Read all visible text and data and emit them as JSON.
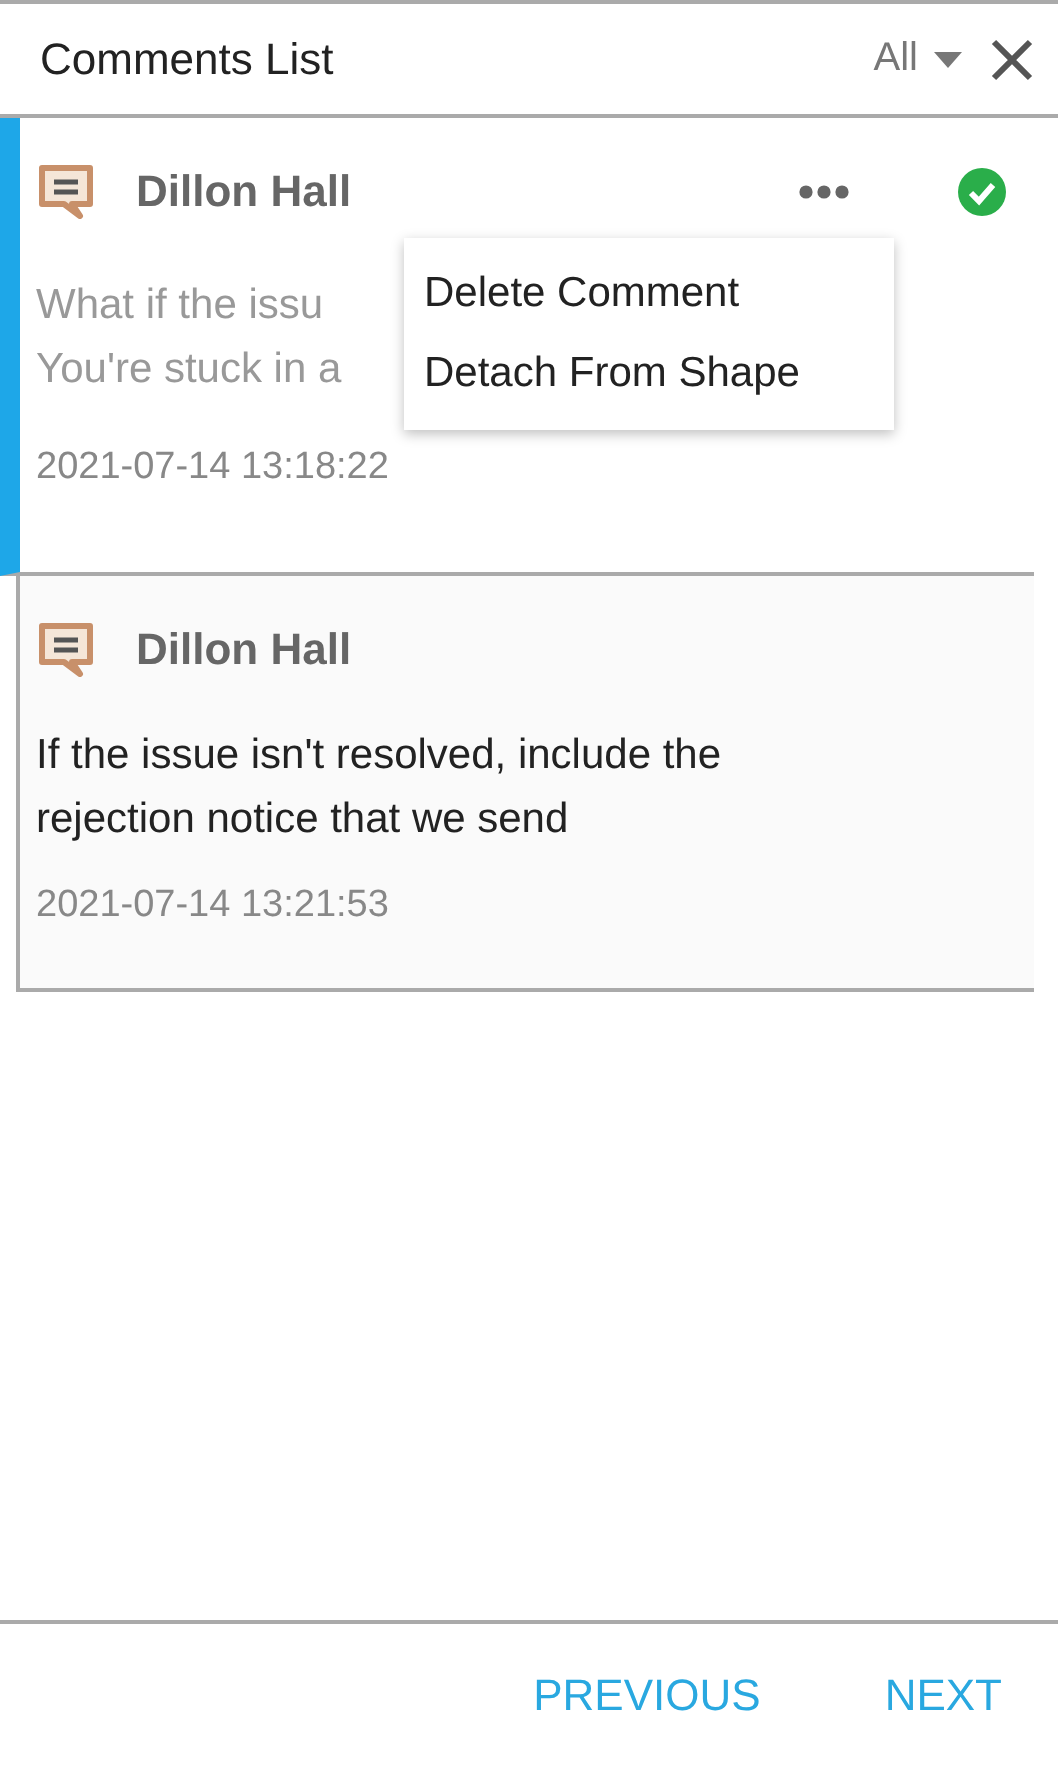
{
  "panel": {
    "title": "Comments List",
    "filter": "All"
  },
  "comments": [
    {
      "author": "Dillon Hall",
      "text_lines": [
        "What if the issu",
        "You're stuck in a"
      ],
      "timestamp": "2021-07-14 13:18:22",
      "selected": true,
      "resolved": true,
      "menu": [
        "Delete Comment",
        "Detach From Shape"
      ]
    },
    {
      "author": "Dillon Hall",
      "text_lines": [
        "If the issue isn't resolved, include the",
        "rejection notice that we send"
      ],
      "timestamp": "2021-07-14 13:21:53",
      "selected": false,
      "resolved": false
    }
  ],
  "footer": {
    "buttons": [
      "PREVIOUS",
      "NEXT"
    ]
  }
}
